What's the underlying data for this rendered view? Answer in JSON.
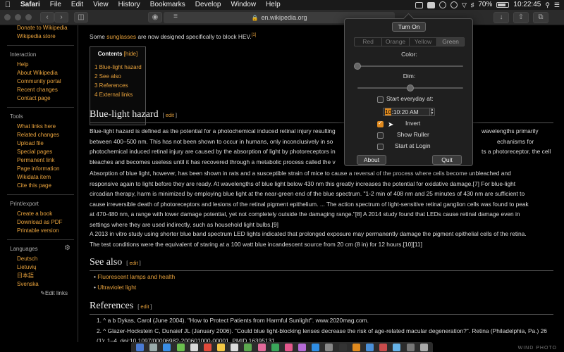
{
  "menubar": {
    "apple": "",
    "menus": [
      "Safari",
      "File",
      "Edit",
      "View",
      "History",
      "Bookmarks",
      "Develop",
      "Window",
      "Help"
    ],
    "battery": "70%",
    "time": "10:22:45"
  },
  "toolbar": {
    "url": "en.wikipedia.org",
    "back": "‹",
    "forward": "›",
    "sidebar_icon": "sidebar-icon",
    "share_icon": "share-icon"
  },
  "sidebar": {
    "top_links": [
      "Donate to Wikipedia",
      "Wikipedia store"
    ],
    "interaction_title": "Interaction",
    "interaction": [
      "Help",
      "About Wikipedia",
      "Community portal",
      "Recent changes",
      "Contact page"
    ],
    "tools_title": "Tools",
    "tools": [
      "What links here",
      "Related changes",
      "Upload file",
      "Special pages",
      "Permanent link",
      "Page information",
      "Wikidata item",
      "Cite this page"
    ],
    "print_title": "Print/export",
    "print": [
      "Create a book",
      "Download as PDF",
      "Printable version"
    ],
    "languages_title": "Languages",
    "languages": [
      "Deutsch",
      "Lietuvių",
      "日本語",
      "Svenska"
    ],
    "edit_links": "Edit links"
  },
  "article": {
    "intro_a": "Some ",
    "intro_link": "sunglasses",
    "intro_b": " are now designed specifically to block HEV.",
    "intro_ref": "[1]",
    "toc": {
      "title": "Contents",
      "hide": "[hide]",
      "items": [
        "1  Blue-light hazard",
        "2  See also",
        "3  References",
        "4  External links"
      ]
    },
    "h_blue": "Blue-light hazard",
    "edit": "edit",
    "p1": [
      "Blue-light hazard is defined as the potential for a photochemical induced retinal injury resulting",
      "between 400–500 nm. This has not been shown to occur in humans, only inconclusively in so",
      "photochemical induced retinal injury are caused by the absorption of light by photoreceptors in",
      "bleaches and becomes useless until it has recovered through a metabolic process called the v"
    ],
    "p1_right": [
      "wavelengths primarily",
      "echanisms for",
      "ts a photoreceptor, the cell"
    ],
    "p2": [
      "Absorption of blue light, however, has been shown in rats and a susceptible strain of mice to cause a reversal of the process where cells become unbleached and",
      "responsive again to light before they are ready. At wavelengths of blue light below 430 nm this greatly increases the potential for oxidative damage.[7] For blue-light",
      "circadian therapy, harm is minimized by employing blue light at the near-green end of the blue spectrum. \"1-2 min of 408 nm and 25 minutes of 430 nm are sufficient to",
      "cause irreversible death of photoreceptors and lesions of the retinal pigment epithelium. ... The action spectrum of light-sensitive retinal ganglion cells was found to peak",
      "at 470-480 nm, a range with lower damage potential, yet not completely outside the damaging range.\"[8] A 2014 study found that LEDs cause retinal damage even in",
      "settings where they are used indirectly, such as household light bulbs.[9]"
    ],
    "p3": [
      "A 2013 in vitro study using shorter blue band spectrum LED lights indicated that prolonged exposure may permanently damage the pigment epithelial cells of the retina.",
      "The test conditions were the equivalent of staring at a 100 watt blue incandescent source from 20 cm (8 in) for 12 hours.[10][11]"
    ],
    "h_see": "See also",
    "see_also": [
      "Fluorescent lamps and health",
      "Ultraviolet light"
    ],
    "h_refs": "References",
    "refs": [
      "1.  ^ a b Dykas, Carol (June 2004). \"How to Protect Patients from Harmful Sunlight\". www.2020mag.com.",
      "2.  ^ Glazer-Hockstein C, Dunaief JL (January 2006). \"Could blue light-blocking lenses decrease the risk of age-related macular degeneration?\". Retina (Philadelphia, Pa.) 26",
      "     (1): 1–4. doi:10.1097/00006982-200601000-00001. PMID 16395131."
    ]
  },
  "popover": {
    "turn_on": "Turn On",
    "colors": [
      "Red",
      "Orange",
      "Yellow",
      "Green"
    ],
    "color_label": "Color:",
    "color_value": 0.0,
    "dim_label": "Dim:",
    "dim_value": 0.5,
    "start_everyday": "Start everyday at:",
    "time_hour": "10",
    "time_rest": ":10:20 AM",
    "invert": "Invert",
    "show_ruller": "Show Ruller",
    "start_login": "Start at Login",
    "about": "About",
    "quit": "Quit"
  },
  "watermark": "WIND PHOTO",
  "colors": {
    "accent": "#e8a23c",
    "check": "#e08a1e"
  }
}
